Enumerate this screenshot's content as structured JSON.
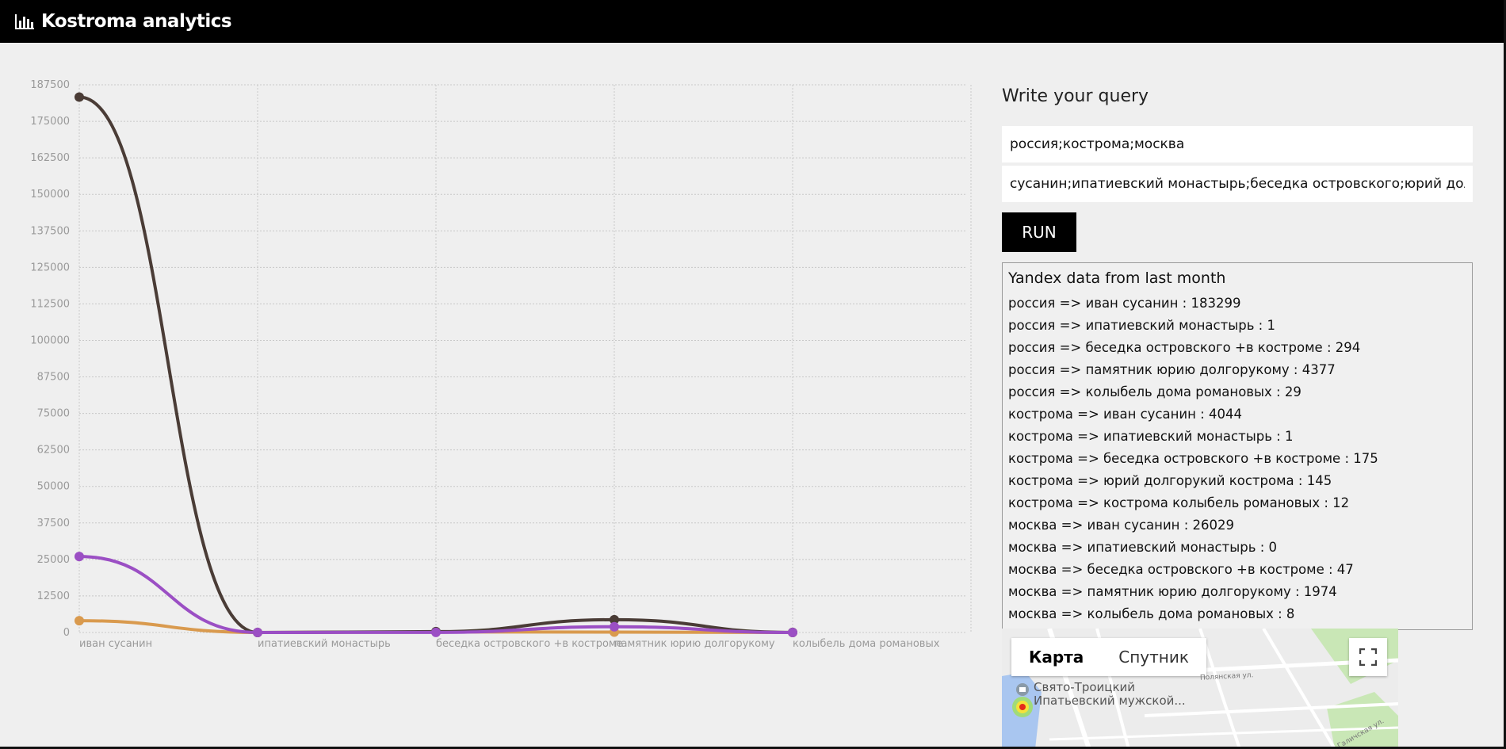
{
  "app": {
    "title": "Kostroma analytics"
  },
  "query": {
    "title": "Write your query",
    "places_value": "россия;кострома;москва",
    "topics_value": "сусанин;ипатиевский монастырь;беседка островского;юрий долгорукий;колыбель романовых",
    "run_label": "RUN"
  },
  "results": {
    "title": "Yandex data from last month",
    "lines": [
      "россия => иван сусанин : 183299",
      "россия => ипатиевский монастырь : 1",
      "россия => беседка островского +в костроме : 294",
      "россия => памятник юрию долгорукому : 4377",
      "россия => колыбель дома романовых : 29",
      "кострома => иван сусанин : 4044",
      "кострома => ипатиевский монастырь : 1",
      "кострома => беседка островского +в костроме : 175",
      "кострома => юрий долгорукий кострома : 145",
      "кострома => кострома колыбель романовых : 12",
      "москва => иван сусанин : 26029",
      "москва => ипатиевский монастырь : 0",
      "москва => беседка островского +в костроме : 47",
      "москва => памятник юрию долгорукому : 1974",
      "москва => колыбель дома романовых : 8"
    ]
  },
  "map": {
    "tab_map": "Карта",
    "tab_satellite": "Спутник",
    "place_line1": "Свято-Троицкий",
    "place_line2": "Ипатьевский мужской...",
    "street1": "Полянская ул.",
    "street2": "Галичская ул."
  },
  "colors": {
    "series_russia": "#4a3c36",
    "series_kostroma": "#d99a4e",
    "series_moscow": "#9b4fc4",
    "grid": "#c8c8c8",
    "tick": "#9a9a9a"
  },
  "chart_data": {
    "type": "line",
    "categories": [
      "иван сусанин",
      "ипатиевский монастырь",
      "беседка островского +в костроме",
      "памятник юрию долгорукому",
      "колыбель дома романовых"
    ],
    "series": [
      {
        "values": [
          183299,
          1,
          294,
          4377,
          29
        ],
        "color": "#4a3c36"
      },
      {
        "values": [
          4044,
          1,
          175,
          145,
          12
        ],
        "color": "#d99a4e"
      },
      {
        "values": [
          26029,
          0,
          47,
          1974,
          8
        ],
        "color": "#9b4fc4"
      }
    ],
    "y_ticks": [
      0,
      12500,
      25000,
      37500,
      50000,
      62500,
      75000,
      87500,
      100000,
      112500,
      125000,
      137500,
      150000,
      162500,
      175000,
      187500
    ],
    "ylim": [
      0,
      187500
    ],
    "grid": true,
    "smooth": true
  }
}
